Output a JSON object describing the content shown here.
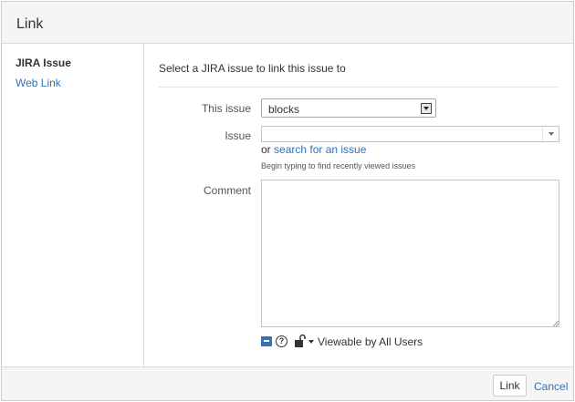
{
  "dialog": {
    "title": "Link"
  },
  "sidebar": {
    "items": [
      {
        "label": "JIRA Issue"
      },
      {
        "label": "Web Link"
      }
    ]
  },
  "main": {
    "intro": "Select a JIRA issue to link this issue to",
    "this_issue": {
      "label": "This issue",
      "value": "blocks"
    },
    "issue": {
      "label": "Issue",
      "value": "",
      "or_text": "or",
      "search_link": "search for an issue",
      "hint": "Begin typing to find recently viewed issues"
    },
    "comment": {
      "label": "Comment",
      "value": ""
    },
    "toolbar": {
      "help_glyph": "?",
      "viewable": "Viewable by All Users"
    }
  },
  "footer": {
    "link_button": "Link",
    "cancel": "Cancel"
  },
  "colors": {
    "link": "#3572b0",
    "header_bg": "#f5f5f5",
    "border": "#d9dcdf"
  }
}
